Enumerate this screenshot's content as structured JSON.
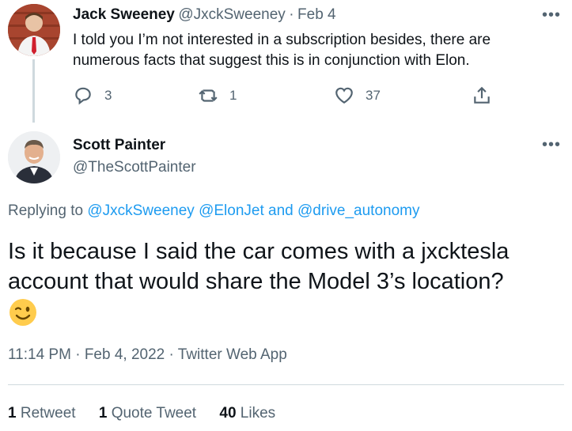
{
  "parent_tweet": {
    "author_name": "Jack Sweeney",
    "author_handle": "@JxckSweeney",
    "separator": "·",
    "date": "Feb 4",
    "text": "I told you I’m not interested in a subscription besides, there are numerous facts that suggest this is in conjunction with Elon.",
    "more_label": "•••",
    "replies": "3",
    "retweets": "1",
    "likes": "37"
  },
  "main_tweet": {
    "author_name": "Scott Painter",
    "author_handle": "@TheScottPainter",
    "more_label": "•••",
    "replying_label": "Replying to",
    "replying_users": [
      "@JxckSweeney",
      "@ElonJet"
    ],
    "replying_and": "and",
    "replying_last": "@drive_autonomy",
    "text": "Is it because I said the car comes with a jxcktesla account that would share the Model 3’s location?",
    "emoji": "winking-face",
    "time": "11:14 PM",
    "date": "Feb 4, 2022",
    "meta_separator": "·",
    "source": "Twitter Web App"
  },
  "stats": {
    "retweets_count": "1",
    "retweets_label": "Retweet",
    "quotes_count": "1",
    "quotes_label": "Quote Tweet",
    "likes_count": "40",
    "likes_label": "Likes"
  },
  "colors": {
    "link": "#1d9bf0",
    "muted": "#536471",
    "text": "#0f1419",
    "divider": "#cfd9de"
  }
}
